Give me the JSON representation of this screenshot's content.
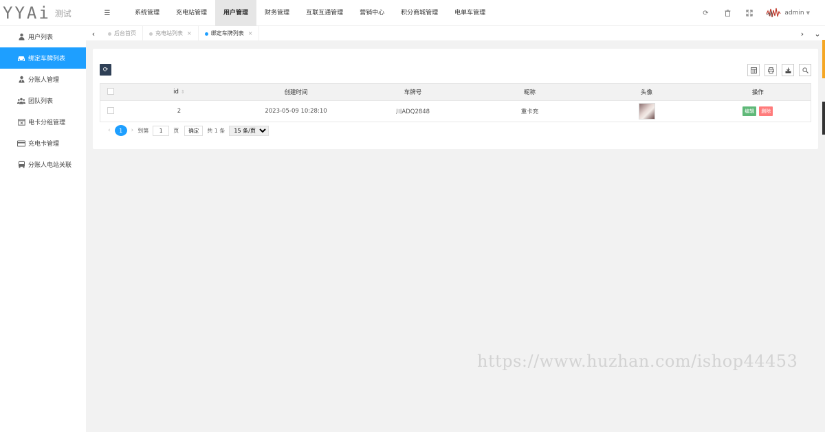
{
  "brand": {
    "logo_text": "YYAi",
    "env_label": "测试"
  },
  "top_nav": {
    "items": [
      "系统管理",
      "充电站管理",
      "用户管理",
      "财务管理",
      "互联互通管理",
      "营销中心",
      "积分商城管理",
      "电单车管理"
    ],
    "active_index": 2
  },
  "header": {
    "user": "admin"
  },
  "sidebar": {
    "items": [
      {
        "label": "用户列表",
        "icon": "users-icon"
      },
      {
        "label": "绑定车牌列表",
        "icon": "car-icon"
      },
      {
        "label": "分账人管理",
        "icon": "user-tie-icon"
      },
      {
        "label": "团队列表",
        "icon": "team-icon"
      },
      {
        "label": "电卡分组管理",
        "icon": "calendar-x-icon"
      },
      {
        "label": "充电卡管理",
        "icon": "card-icon"
      },
      {
        "label": "分账人电站关联",
        "icon": "bus-icon"
      }
    ],
    "active_index": 1
  },
  "tabs": [
    {
      "label": "后台首页",
      "closable": false
    },
    {
      "label": "充电站列表",
      "closable": true
    },
    {
      "label": "绑定车牌列表",
      "closable": true,
      "active": true
    }
  ],
  "table": {
    "headers": {
      "id": "id",
      "created": "创建时间",
      "plate": "车牌号",
      "nickname": "昵称",
      "avatar": "头像",
      "actions": "操作"
    },
    "rows": [
      {
        "id": "2",
        "created": "2023-05-09 10:28:10",
        "plate": "川ADQ2848",
        "nickname": "重卡充"
      }
    ],
    "edit_label": "编辑",
    "delete_label": "删除"
  },
  "pager": {
    "current": "1",
    "goto_prefix": "到第",
    "goto_value": "1",
    "goto_suffix": "页",
    "confirm": "确定",
    "total": "共 1 条",
    "page_size": "15 条/页"
  },
  "watermark": "https://www.huzhan.com/ishop44453",
  "colors": {
    "primary": "#1e9fff",
    "dark_btn": "#2f4056",
    "edit": "#5fb878",
    "delete": "#ff7b7b"
  }
}
